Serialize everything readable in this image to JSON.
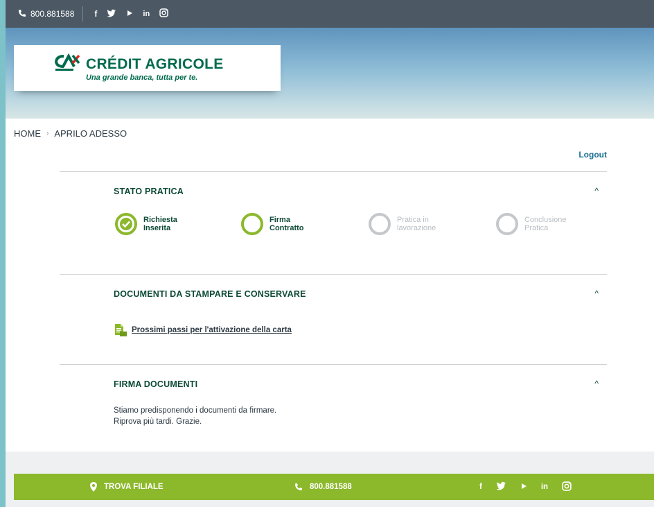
{
  "topbar": {
    "phone": "800.881588",
    "socials": [
      "f",
      "twitter",
      "youtube",
      "in",
      "instagram"
    ]
  },
  "header": {
    "brand_name": "CRÉDIT AGRICOLE",
    "tagline": "Una grande banca, tutta per te."
  },
  "breadcrumb": {
    "home": "HOME",
    "current": "APRILO ADESSO"
  },
  "logout_label": "Logout",
  "stato_pratica": {
    "title": "STATO PRATICA",
    "steps": [
      {
        "line1": "Richiesta",
        "line2": "Inserita",
        "state": "done"
      },
      {
        "line1": "Firma",
        "line2": "Contratto",
        "state": "current"
      },
      {
        "line1": "Pratica in",
        "line2": "lavorazione",
        "state": "pending"
      },
      {
        "line1": "Conclusione",
        "line2": "Pratica",
        "state": "pending"
      }
    ]
  },
  "documenti": {
    "title": "DOCUMENTI DA STAMPARE E CONSERVARE",
    "link": "Prossimi passi per l'attivazione della carta"
  },
  "firma_documenti": {
    "title": "FIRMA DOCUMENTI",
    "message_line1": "Stiamo predisponendo i documenti da firmare.",
    "message_line2": "Riprova più tardi. Grazie."
  },
  "footer": {
    "trova_filiale": "TROVA FILIALE",
    "phone": "800.881588"
  },
  "colors": {
    "brand_green": "#006a4d",
    "accent_green": "#8cb82c",
    "topbar": "#4c5965",
    "link_blue": "#1c6f93"
  }
}
